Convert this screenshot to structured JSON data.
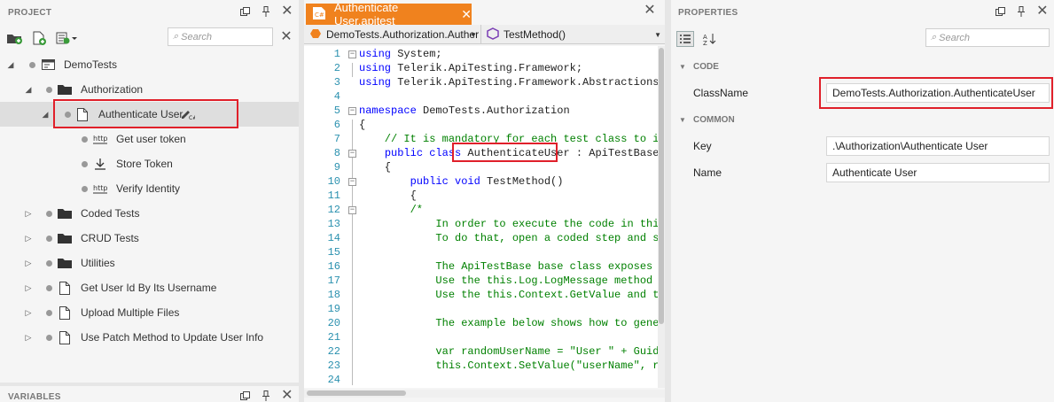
{
  "project": {
    "header": "PROJECT",
    "search_placeholder": "Search",
    "tree": [
      {
        "label": "DemoTests",
        "icon": "solution-icon",
        "expander": "expanded"
      },
      {
        "label": "Authorization",
        "icon": "folder-icon",
        "expander": "expanded"
      },
      {
        "label": "Authenticate User",
        "icon": "test-file-icon",
        "expander": "expanded",
        "badge_icon": "coded-step-icon"
      },
      {
        "label": "Get user token",
        "icon": "http-request-icon"
      },
      {
        "label": "Store Token",
        "icon": "download-icon"
      },
      {
        "label": "Verify Identity",
        "icon": "http-request-icon"
      },
      {
        "label": "Coded Tests",
        "icon": "folder-icon",
        "expander": "collapsed"
      },
      {
        "label": "CRUD Tests",
        "icon": "folder-icon",
        "expander": "collapsed"
      },
      {
        "label": "Utilities",
        "icon": "folder-icon",
        "expander": "collapsed"
      },
      {
        "label": "Get User Id By Its Username",
        "icon": "test-file-icon",
        "expander": "collapsed"
      },
      {
        "label": "Upload Multiple Files",
        "icon": "test-file-icon",
        "expander": "collapsed"
      },
      {
        "label": "Use Patch Method to Update User Info",
        "icon": "test-file-icon",
        "expander": "collapsed"
      }
    ]
  },
  "variables": {
    "header": "VARIABLES"
  },
  "editor": {
    "tab_label": "Authenticate User.apitest",
    "class_combo": "DemoTests.Authorization.Auther",
    "method_combo": "TestMethod()",
    "lines": [
      {
        "n": "1",
        "text": "using System;"
      },
      {
        "n": "2",
        "text": "using Telerik.ApiTesting.Framework;"
      },
      {
        "n": "3",
        "text": "using Telerik.ApiTesting.Framework.Abstractions;"
      },
      {
        "n": "4",
        "text": ""
      },
      {
        "n": "5",
        "text": "namespace DemoTests.Authorization"
      },
      {
        "n": "6",
        "text": "{"
      },
      {
        "n": "7",
        "text": "    // It is mandatory for each test class to inhe"
      },
      {
        "n": "8",
        "text": "    public class AuthenticateUser : ApiTestBase"
      },
      {
        "n": "9",
        "text": "    {"
      },
      {
        "n": "10",
        "text": "        public void TestMethod()"
      },
      {
        "n": "11",
        "text": "        {"
      },
      {
        "n": "12",
        "text": "        /*"
      },
      {
        "n": "13",
        "text": "            In order to execute the code in this t"
      },
      {
        "n": "14",
        "text": "            To do that, open a coded step and sele"
      },
      {
        "n": "15",
        "text": ""
      },
      {
        "n": "16",
        "text": "            The ApiTestBase base class exposes Log"
      },
      {
        "n": "17",
        "text": "            Use the this.Log.LogMessage method to"
      },
      {
        "n": "18",
        "text": "            Use the this.Context.GetValue and this"
      },
      {
        "n": "19",
        "text": ""
      },
      {
        "n": "20",
        "text": "            The example below shows how to generat"
      },
      {
        "n": "21",
        "text": ""
      },
      {
        "n": "22",
        "text": "            var randomUserName = \"User \" + Guid.Ne"
      },
      {
        "n": "23",
        "text": "            this.Context.SetValue(\"userName\", rand"
      },
      {
        "n": "24",
        "text": ""
      }
    ]
  },
  "properties": {
    "header": "PROPERTIES",
    "search_placeholder": "Search",
    "categories": [
      {
        "name": "CODE",
        "rows": [
          {
            "name": "ClassName",
            "value": "DemoTests.Authorization.AuthenticateUser"
          }
        ]
      },
      {
        "name": "COMMON",
        "rows": [
          {
            "name": "Key",
            "value": ".\\Authorization\\Authenticate User"
          },
          {
            "name": "Name",
            "value": "Authenticate User"
          }
        ]
      }
    ]
  },
  "colors": {
    "accent": "#f0821e",
    "highlight": "#e0202a",
    "selection": "#dedede"
  }
}
